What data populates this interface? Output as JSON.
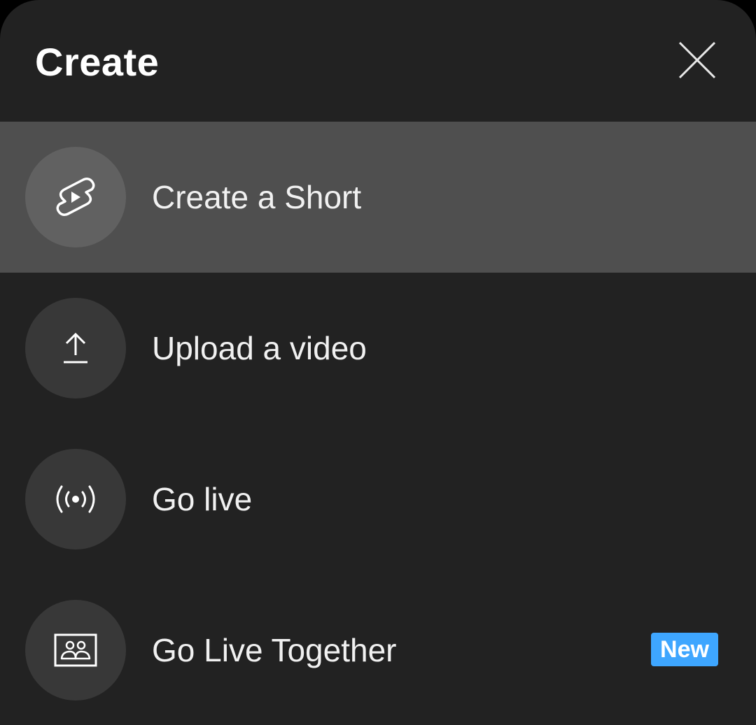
{
  "header": {
    "title": "Create",
    "close_icon": "close-icon"
  },
  "menu": {
    "items": [
      {
        "label": "Create a Short",
        "icon": "shorts-icon",
        "selected": true
      },
      {
        "label": "Upload a video",
        "icon": "upload-icon",
        "selected": false
      },
      {
        "label": "Go live",
        "icon": "live-broadcast-icon",
        "selected": false
      },
      {
        "label": "Go Live Together",
        "icon": "go-live-together-icon",
        "selected": false,
        "badge": "New"
      }
    ]
  },
  "colors": {
    "sheet_background": "#222222",
    "selected_row": "#4f4f4f",
    "icon_circle": "#383838",
    "badge": "#3ea6ff"
  }
}
